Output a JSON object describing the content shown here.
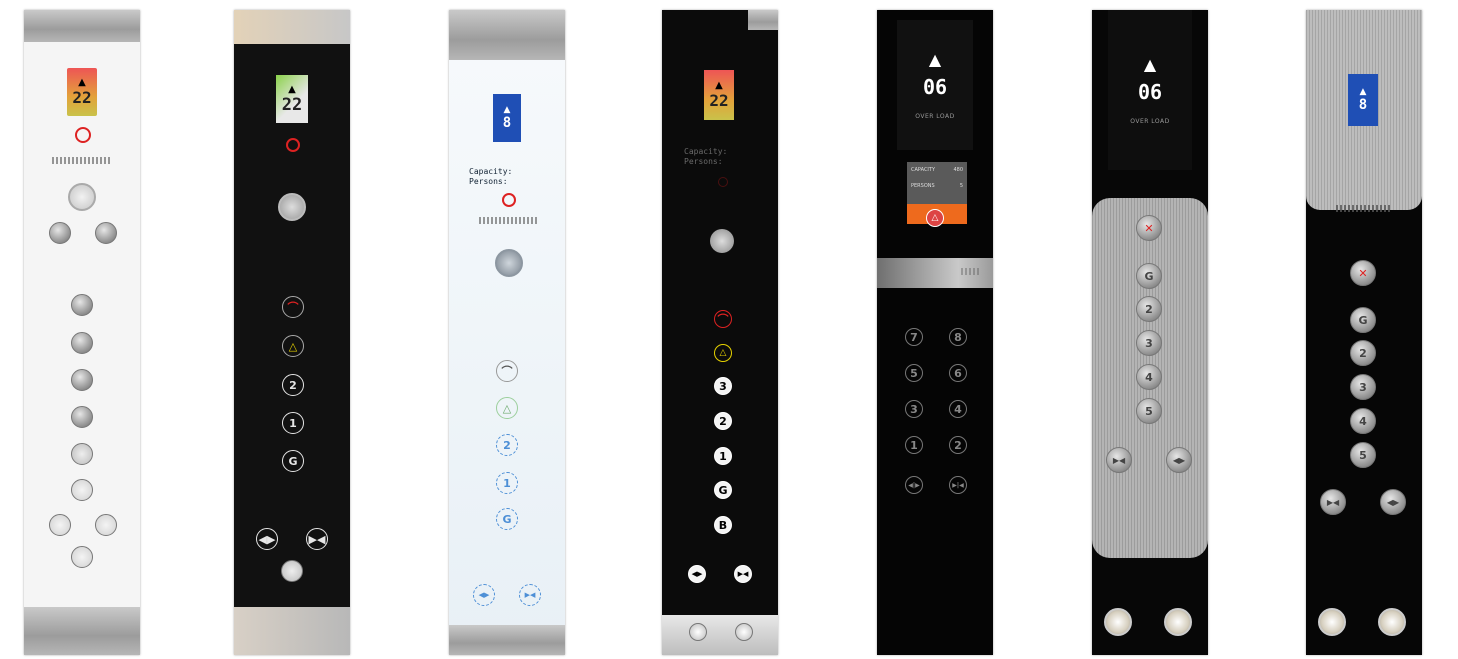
{
  "panels": [
    {
      "display_floor": "22",
      "display_arrow": "▲",
      "buttons": [
        "",
        "",
        "",
        "",
        "",
        "",
        "",
        "",
        "",
        "",
        ""
      ]
    },
    {
      "display_floor": "22",
      "display_arrow": "▲",
      "buttons": [
        "",
        "",
        "2",
        "1",
        "G",
        "",
        ""
      ]
    },
    {
      "display_floor": "8",
      "display_arrow": "▲",
      "capacity_label": "Capacity:",
      "persons_label": "Persons:",
      "buttons": [
        "",
        "",
        "2",
        "1",
        "G",
        "",
        ""
      ]
    },
    {
      "display_floor": "22",
      "display_arrow": "▲",
      "capacity_label": "Capacity:",
      "persons_label": "Persons:",
      "buttons": [
        "",
        "",
        "3",
        "2",
        "1",
        "G",
        "B",
        "",
        ""
      ]
    },
    {
      "display_floor": "06",
      "display_arrow": "▲",
      "display_caption": "OVER LOAD",
      "capacity_label": "CAPACITY",
      "capacity_value": "480",
      "persons_label": "PERSONS",
      "persons_value": "5",
      "keypad": [
        "7",
        "8",
        "5",
        "6",
        "3",
        "4",
        "1",
        "2"
      ],
      "door_open": "◀|▶",
      "door_close": "▶|◀"
    },
    {
      "display_floor": "06",
      "display_arrow": "▲",
      "display_caption": "OVER LOAD",
      "buttons": [
        "",
        "G",
        "2",
        "3",
        "4",
        "5"
      ]
    },
    {
      "display_floor": "8",
      "display_arrow": "▲",
      "buttons": [
        "",
        "G",
        "2",
        "3",
        "4",
        "5"
      ]
    }
  ],
  "colors": {
    "steel": "#b0b0b0",
    "black_glass": "#0d0d0d",
    "orange": "#ee6a1d",
    "blue_display": "#1f4fb5",
    "alarm_yellow": "#e6d200",
    "red": "#d41f1f"
  },
  "icons": [
    "up-arrow-icon",
    "no-smoking-icon",
    "alarm-bell-icon",
    "door-open-icon",
    "door-close-icon",
    "phone-icon",
    "speaker-grille-icon"
  ]
}
